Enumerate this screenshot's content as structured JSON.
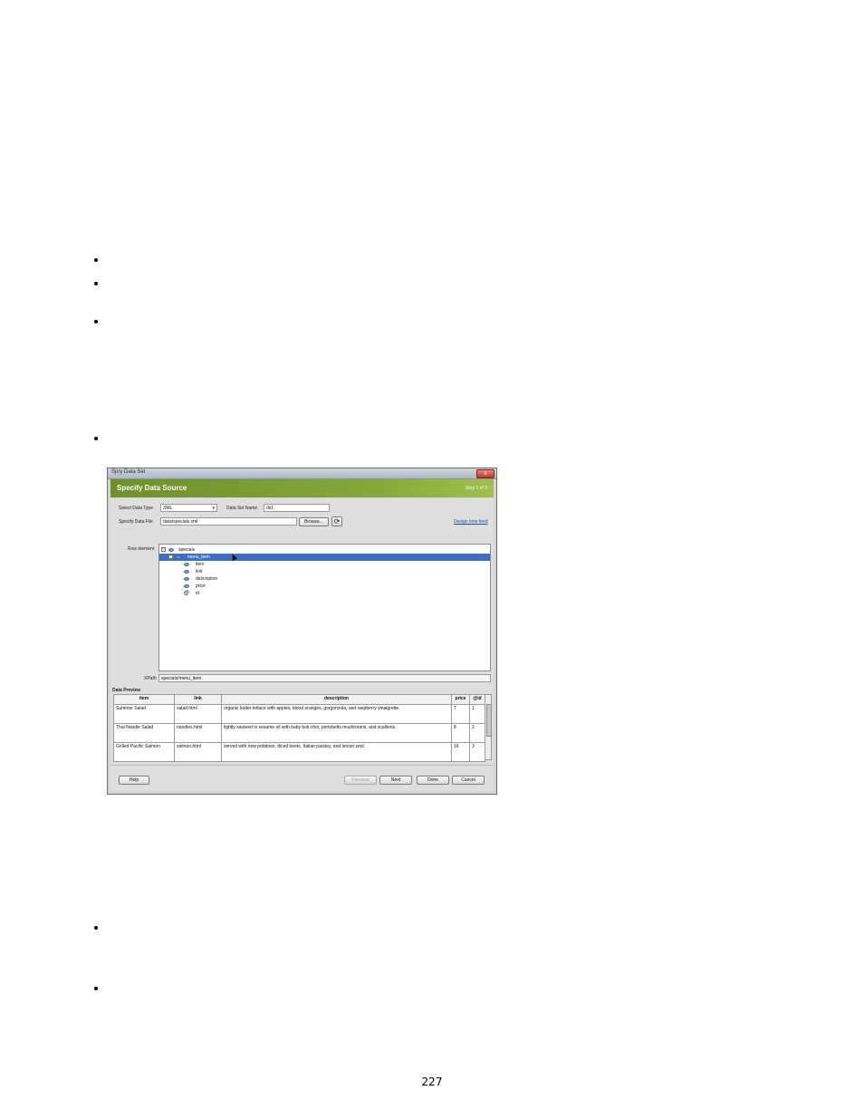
{
  "dialog": {
    "window_title": "Spry Data Set",
    "close_glyph": "x",
    "header_title": "Specify Data Source",
    "step_text": "Step 1 of 3",
    "data_type_label": "Select Data Type",
    "data_type_value": "XML",
    "data_set_name_label": "Data Set Name",
    "data_set_name_value": "ds1",
    "data_file_label": "Specify Data File",
    "data_file_value": "data/specials.xml",
    "browse_button": "Browse...",
    "design_link": "Design time feed",
    "row_element_label": "Row element",
    "tree": [
      {
        "label": "specials",
        "type": "element",
        "expander": "−"
      },
      {
        "label": "menu_item",
        "type": "element",
        "expander": "−",
        "selected": true
      },
      {
        "label": "item",
        "type": "element"
      },
      {
        "label": "link",
        "type": "element"
      },
      {
        "label": "description",
        "type": "element"
      },
      {
        "label": "price",
        "type": "element"
      },
      {
        "label": "id",
        "type": "attribute",
        "glyph": "@"
      }
    ],
    "xpath_label": "XPath",
    "xpath_value": "specials/menu_item",
    "preview_label": "Data Preview",
    "preview_columns": [
      "item",
      "link",
      "description",
      "price",
      "@id"
    ],
    "preview_rows": [
      [
        "Summer Salad",
        "salad.html",
        "organic butter lettuce with apples, blood oranges, gorgonzola, and raspberry vinaigrette.",
        "7",
        "1"
      ],
      [
        "Thai Noodle Salad",
        "noodles.html",
        "lightly sauteed in sesame oil with baby bok choi, portobello mushrooms, and scallions.",
        "8",
        "2"
      ],
      [
        "Grilled Pacific Salmon",
        "salmon.html",
        "served with new potatoes, diced beets, Italian parsley, and lemon zest.",
        "16",
        "3"
      ]
    ],
    "buttons": {
      "help": "Help",
      "previous": "Previous",
      "next": "Next",
      "done": "Done",
      "cancel": "Cancel"
    }
  },
  "page_number": "227"
}
